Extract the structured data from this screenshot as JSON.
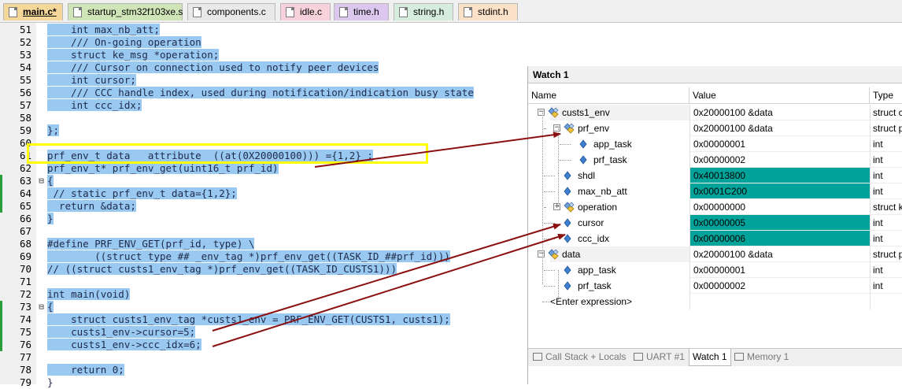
{
  "file_tabs": [
    {
      "label": "main.c*",
      "color": "#f6d79a",
      "active": true
    },
    {
      "label": "startup_stm32f103xe.s",
      "color": "#cfe5b7",
      "active": false
    },
    {
      "label": "components.c",
      "color": "#e9e9e9",
      "active": false
    },
    {
      "label": "idle.c",
      "color": "#f7d2dc",
      "active": false
    },
    {
      "label": "time.h",
      "color": "#dcc8ef",
      "active": false
    },
    {
      "label": "string.h",
      "color": "#d6ecdc",
      "active": false
    },
    {
      "label": "stdint.h",
      "color": "#fbe1c7",
      "active": false
    }
  ],
  "editor": {
    "lines": [
      {
        "num": "51",
        "code": "    int max_nb_att;"
      },
      {
        "num": "52",
        "code": "    /// On-going operation"
      },
      {
        "num": "53",
        "code": "    struct ke_msg *operation;"
      },
      {
        "num": "54",
        "code": "    /// Cursor on connection used to notify peer devices"
      },
      {
        "num": "55",
        "code": "    int cursor;"
      },
      {
        "num": "56",
        "code": "    /// CCC handle index, used during notification/indication busy state"
      },
      {
        "num": "57",
        "code": "    int ccc_idx;"
      },
      {
        "num": "58",
        "code": ""
      },
      {
        "num": "59",
        "code": "};"
      },
      {
        "num": "60",
        "code": ""
      },
      {
        "num": "61",
        "code": "prf_env_t data   attribute  ((at(0X20000100))) ={1,2} ;"
      },
      {
        "num": "62",
        "code": "prf_env_t* prf_env_get(uint16_t prf_id)"
      },
      {
        "num": "63",
        "code": "{"
      },
      {
        "num": "64",
        "code": " // static prf_env_t data={1,2};"
      },
      {
        "num": "65",
        "code": "  return &data;"
      },
      {
        "num": "66",
        "code": "}"
      },
      {
        "num": "67",
        "code": ""
      },
      {
        "num": "68",
        "code": "#define PRF_ENV_GET(prf_id, type) \\"
      },
      {
        "num": "69",
        "code": "        ((struct type ## _env_tag *)prf_env_get((TASK_ID_##prf_id)))"
      },
      {
        "num": "70",
        "code": "// ((struct custs1_env_tag *)prf_env_get((TASK_ID_CUSTS1)))"
      },
      {
        "num": "71",
        "code": ""
      },
      {
        "num": "72",
        "code": "int main(void)"
      },
      {
        "num": "73",
        "code": "{"
      },
      {
        "num": "74",
        "code": "    struct custs1_env_tag *custs1_env = PRF_ENV_GET(CUSTS1, custs1);"
      },
      {
        "num": "75",
        "code": "    custs1_env->cursor=5;"
      },
      {
        "num": "76",
        "code": "    custs1_env->ccc_idx=6;"
      },
      {
        "num": "77",
        "code": ""
      },
      {
        "num": "78",
        "code": "    return 0;"
      },
      {
        "num": "79",
        "code": "}"
      }
    ],
    "highlight_color": "#99c9f1"
  },
  "watch": {
    "title": "Watch 1",
    "columns": {
      "name": "Name",
      "value": "Value",
      "type": "Type"
    },
    "rows": [
      {
        "name": "custs1_env",
        "value": "0x20000100 &data",
        "type": "struct c",
        "changed": false,
        "icon": "struct-icon"
      },
      {
        "name": "prf_env",
        "value": "0x20000100 &data",
        "type": "struct p",
        "changed": false,
        "icon": "struct-icon"
      },
      {
        "name": "app_task",
        "value": "0x00000001",
        "type": "int",
        "changed": false,
        "icon": "variable-icon"
      },
      {
        "name": "prf_task",
        "value": "0x00000002",
        "type": "int",
        "changed": false,
        "icon": "variable-icon"
      },
      {
        "name": "shdl",
        "value": "0x40013800",
        "type": "int",
        "changed": true,
        "icon": "variable-icon"
      },
      {
        "name": "max_nb_att",
        "value": "0x0001C200",
        "type": "int",
        "changed": true,
        "icon": "variable-icon"
      },
      {
        "name": "operation",
        "value": "0x00000000",
        "type": "struct k",
        "changed": false,
        "icon": "struct-icon"
      },
      {
        "name": "cursor",
        "value": "0x00000005",
        "type": "int",
        "changed": true,
        "icon": "variable-icon"
      },
      {
        "name": "ccc_idx",
        "value": "0x00000006",
        "type": "int",
        "changed": true,
        "icon": "variable-icon"
      },
      {
        "name": "data",
        "value": "0x20000100 &data",
        "type": "struct p",
        "changed": false,
        "icon": "struct-icon"
      },
      {
        "name": "app_task",
        "value": "0x00000001",
        "type": "int",
        "changed": false,
        "icon": "variable-icon"
      },
      {
        "name": "prf_task",
        "value": "0x00000002",
        "type": "int",
        "changed": false,
        "icon": "variable-icon"
      }
    ],
    "enter_expression": "<Enter expression>",
    "changed_color": "#00a39a"
  },
  "bottom_tabs": [
    {
      "label": "Call Stack + Locals",
      "active": false,
      "icon": "call-stack-icon"
    },
    {
      "label": "UART #1",
      "active": false,
      "icon": "uart-icon"
    },
    {
      "label": "Watch 1",
      "active": true,
      "icon": ""
    },
    {
      "label": "Memory 1",
      "active": false,
      "icon": "memory-icon"
    }
  ],
  "annotation_color": "#8b0f0f"
}
